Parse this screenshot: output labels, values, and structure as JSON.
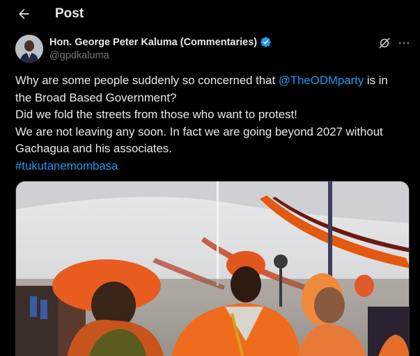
{
  "header": {
    "title": "Post"
  },
  "author": {
    "name": "Hon. George Peter Kaluma (Commentaries)",
    "handle": "@gpdkaluma"
  },
  "tweet": {
    "line1_before": "Why are some people suddenly so concerned that ",
    "mention": "@TheODMparty",
    "line1_after": " is in",
    "line2": "the Broad Based Government?",
    "line3": "Did we fold the streets from those who want to protest!",
    "line4": "We are not leaving any soon. In fact we are going beyond 2027 without",
    "line5": "Gachagua and his associates.",
    "hashtag": "#tukutanemombasa"
  },
  "colors": {
    "link": "#1d9bf0",
    "verified": "#1d9bf0",
    "muted": "#71767b",
    "text": "#e7e9ea",
    "background": "#000000"
  },
  "icons": {
    "back": "arrow-left-icon",
    "verified": "verified-badge-icon",
    "grok": "grok-icon",
    "more": "more-horizontal-icon"
  }
}
